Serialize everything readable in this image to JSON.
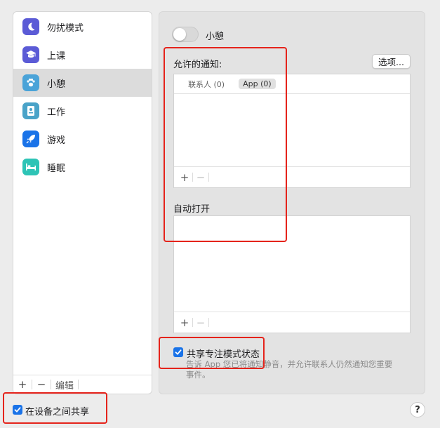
{
  "sidebar": {
    "items": [
      {
        "label": "勿扰模式",
        "icon": "moon-icon",
        "color": "#5b5bd6"
      },
      {
        "label": "上课",
        "icon": "graduation-cap-icon",
        "color": "#5b5bd6"
      },
      {
        "label": "小憩",
        "icon": "paw-icon",
        "color": "#4aa3d8"
      },
      {
        "label": "工作",
        "icon": "badge-icon",
        "color": "#4aa3c8"
      },
      {
        "label": "游戏",
        "icon": "rocket-icon",
        "color": "#1a73e8"
      },
      {
        "label": "睡眠",
        "icon": "bed-icon",
        "color": "#2ec4b6"
      }
    ],
    "selected_index": 2,
    "footer": {
      "add": "+",
      "remove": "−",
      "edit": "编辑"
    }
  },
  "focus": {
    "name": "小憩",
    "allowed_title": "允许的通知:",
    "options_button": "选项...",
    "tabs": [
      "联系人 (0)",
      "App (0)"
    ],
    "auto_title": "自动打开",
    "add": "+",
    "remove": "−",
    "share_status_label": "共享专注模式状态",
    "share_status_desc": "告诉 App 您已将通知静音，并允许联系人仍然通知您重要事件。"
  },
  "share_devices_label": "在设备之间共享",
  "help": "?",
  "colors": {
    "accent": "#1a73e8",
    "highlight": "#e5231b"
  }
}
